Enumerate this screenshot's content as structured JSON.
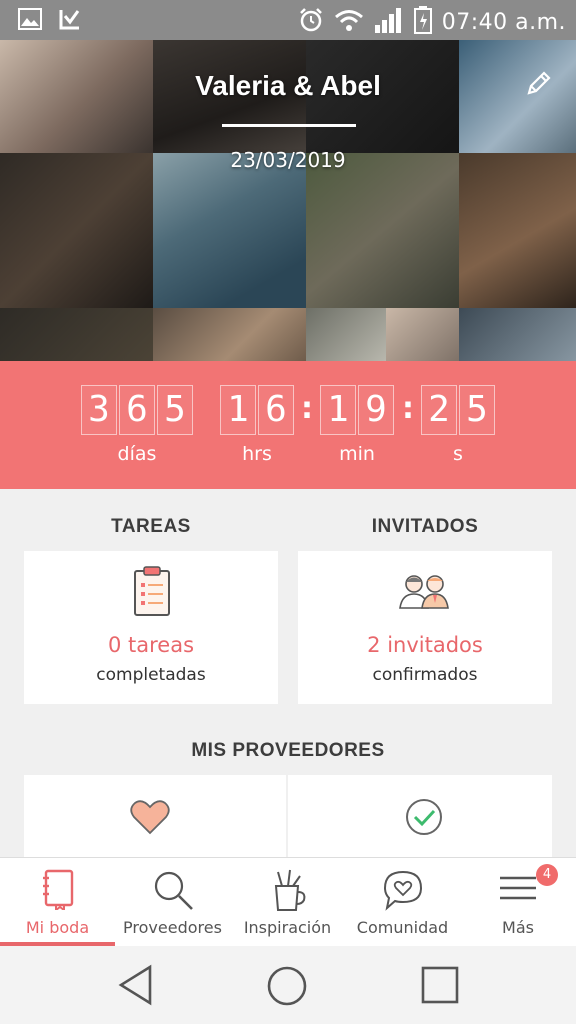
{
  "status_bar": {
    "time": "07:40 a.m."
  },
  "hero": {
    "couple_names": "Valeria & Abel",
    "wedding_date": "23/03/2019"
  },
  "countdown": {
    "days_digits": [
      "3",
      "6",
      "5"
    ],
    "hours_digits": [
      "1",
      "6"
    ],
    "minutes_digits": [
      "1",
      "9"
    ],
    "seconds_digits": [
      "2",
      "5"
    ],
    "labels": {
      "days": "días",
      "hours": "hrs",
      "minutes": "min",
      "seconds": "s"
    }
  },
  "tasks": {
    "section_title": "TAREAS",
    "count_text": "0 tareas",
    "sub_text": "completadas"
  },
  "guests": {
    "section_title": "INVITADOS",
    "count_text": "2 invitados",
    "sub_text": "confirmados"
  },
  "vendors": {
    "section_title": "MIS PROVEEDORES"
  },
  "bottom_nav": {
    "items": [
      {
        "label": "Mi boda"
      },
      {
        "label": "Proveedores"
      },
      {
        "label": "Inspiración"
      },
      {
        "label": "Comunidad"
      },
      {
        "label": "Más",
        "badge": "4"
      }
    ]
  },
  "colors": {
    "accent": "#f27474",
    "accent_text": "#e8676b"
  },
  "icons": [
    "image-icon",
    "app-notification-icon",
    "alarm-icon",
    "wifi-icon",
    "signal-icon",
    "battery-icon",
    "edit-pencil-icon",
    "clipboard-checklist-icon",
    "couple-guests-icon",
    "heart-icon",
    "check-circle-icon",
    "notebook-icon",
    "magnifier-icon",
    "pencil-cup-icon",
    "chat-heart-icon",
    "menu-icon",
    "back-triangle-icon",
    "home-circle-icon",
    "recents-square-icon"
  ]
}
